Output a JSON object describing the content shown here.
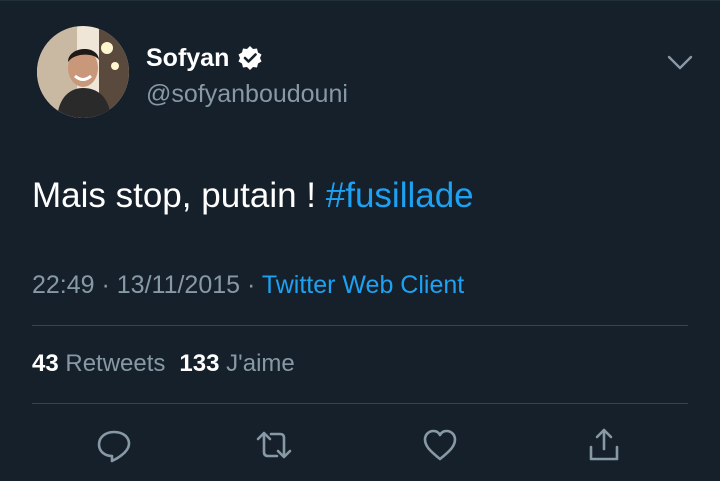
{
  "user": {
    "display_name": "Sofyan",
    "handle": "@sofyanboudouni",
    "verified": true,
    "avatar_icon": "profile-photo"
  },
  "tweet": {
    "text": "Mais stop, putain ! ",
    "hashtag": "#fusillade"
  },
  "meta": {
    "time": "22:49",
    "separator1": " · ",
    "date": "13/11/2015",
    "separator2": " · ",
    "client": "Twitter Web Client"
  },
  "stats": {
    "retweets_count": "43",
    "retweets_label": "Retweets",
    "likes_count": "133",
    "likes_label": "J'aime"
  },
  "actions": [
    {
      "name": "reply",
      "icon": "comment-icon"
    },
    {
      "name": "retweet",
      "icon": "retweet-icon"
    },
    {
      "name": "like",
      "icon": "heart-icon"
    },
    {
      "name": "share",
      "icon": "share-icon"
    }
  ],
  "colors": {
    "background": "#15202b",
    "text": "#ffffff",
    "secondary": "#8899a6",
    "accent": "#1da1f2",
    "divider": "#38444d"
  }
}
